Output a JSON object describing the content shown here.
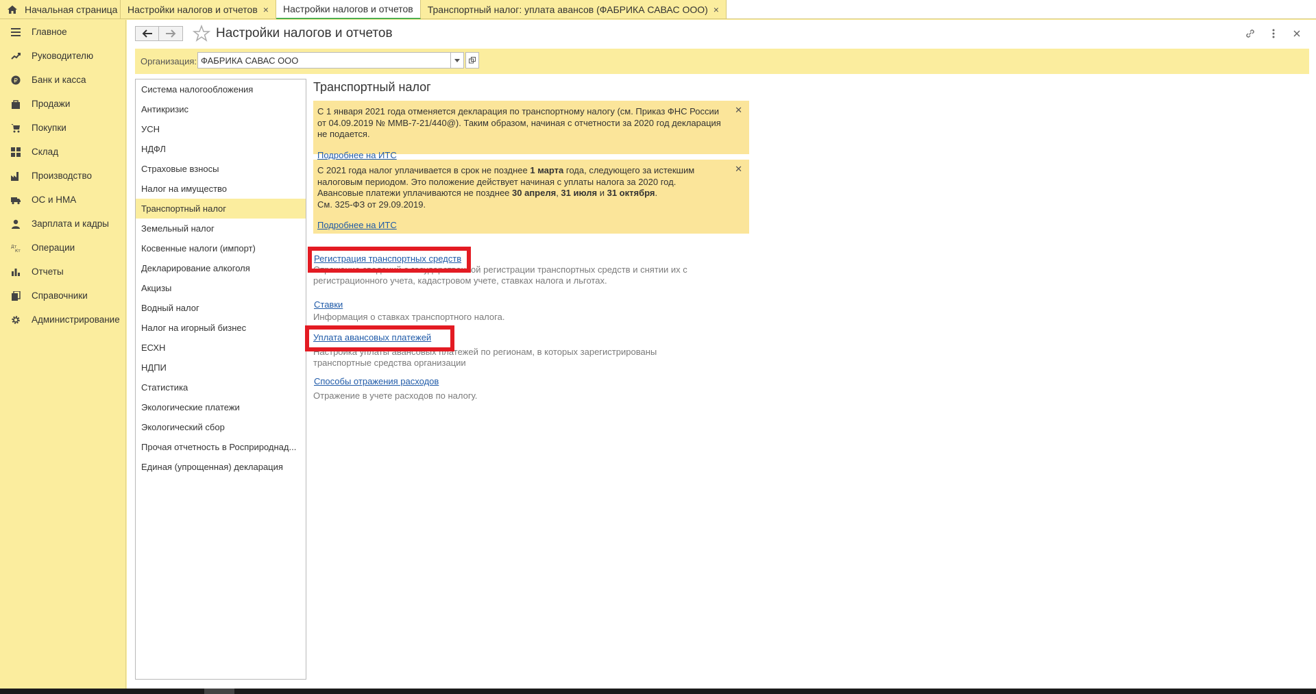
{
  "tabs": {
    "home": "Начальная страница",
    "tab1": "Настройки налогов и отчетов",
    "tab2": "Настройки налогов и отчетов",
    "tab3": "Транспортный налог: уплата авансов (ФАБРИКА САВАС ООО)",
    "close": "×"
  },
  "sidebar": {
    "items": [
      {
        "label": "Главное",
        "icon": "menu-icon"
      },
      {
        "label": "Руководителю",
        "icon": "trend-icon"
      },
      {
        "label": "Банк и касса",
        "icon": "ruble-icon"
      },
      {
        "label": "Продажи",
        "icon": "bag-icon"
      },
      {
        "label": "Покупки",
        "icon": "cart-icon"
      },
      {
        "label": "Склад",
        "icon": "grid-icon"
      },
      {
        "label": "Производство",
        "icon": "factory-icon"
      },
      {
        "label": "ОС и НМА",
        "icon": "truck-icon"
      },
      {
        "label": "Зарплата и кадры",
        "icon": "person-icon"
      },
      {
        "label": "Операции",
        "icon": "dt-kt-icon"
      },
      {
        "label": "Отчеты",
        "icon": "bar-chart-icon"
      },
      {
        "label": "Справочники",
        "icon": "books-icon"
      },
      {
        "label": "Администрирование",
        "icon": "gear-icon"
      }
    ]
  },
  "header": {
    "title": "Настройки налогов и отчетов"
  },
  "org": {
    "label": "Организация:",
    "value": "ФАБРИКА САВАС ООО"
  },
  "sections": [
    "Система налогообложения",
    "Антикризис",
    "УСН",
    "НДФЛ",
    "Страховые взносы",
    "Налог на имущество",
    "Транспортный налог",
    "Земельный налог",
    "Косвенные налоги (импорт)",
    "Декларирование алкоголя",
    "Акцизы",
    "Водный налог",
    "Налог на игорный бизнес",
    "ЕСХН",
    "НДПИ",
    "Статистика",
    "Экологические платежи",
    "Экологический сбор",
    "Прочая отчетность в Росприроднад...",
    "Единая (упрощенная) декларация"
  ],
  "active_section_index": 6,
  "content": {
    "title": "Транспортный налог",
    "notice1": {
      "text": "С 1 января 2021 года отменяется декларация по транспортному налогу (см. Приказ ФНС России от 04.09.2019 № ММВ-7-21/440@). Таким образом, начиная с отчетности за 2020 год декларация не подается.",
      "link": "Подробнее на ИТС"
    },
    "notice2": {
      "p1": "С 2021 года налог уплачивается в срок не позднее ",
      "b1": "1 марта",
      "p2": " года, следующего за истекшим налоговым периодом. Это положение действует начиная с уплаты налога за 2020 год.",
      "p3": "Авансовые платежи уплачиваются не позднее ",
      "b2": "30 апреля",
      "sep1": ", ",
      "b3": "31 июля",
      "sep2": " и ",
      "b4": "31 октября",
      "p4": ".",
      "p5": "См. 325-ФЗ от 29.09.2019.",
      "link": "Подробнее на ИТС"
    },
    "links": [
      {
        "label": "Регистрация транспортных средств",
        "desc": "Отражение сведений о государственной регистрации транспортных средств и снятии их с регистрационного учета, кадастровом учете, ставках налога и льготах."
      },
      {
        "label": "Ставки",
        "desc": "Информация о ставках транспортного налога."
      },
      {
        "label": "Уплата авансовых платежей",
        "desc": "Настройка уплаты авансовых платежей по регионам, в которых зарегистрированы транспортные средства организации"
      },
      {
        "label": "Способы отражения расходов",
        "desc": "Отражение в учете расходов по налогу."
      }
    ]
  },
  "colors": {
    "accent_yellow": "#fbed9e",
    "highlight_red": "#e31b23",
    "link_blue": "#1f5aa8",
    "active_tab_green": "#4caf50"
  }
}
